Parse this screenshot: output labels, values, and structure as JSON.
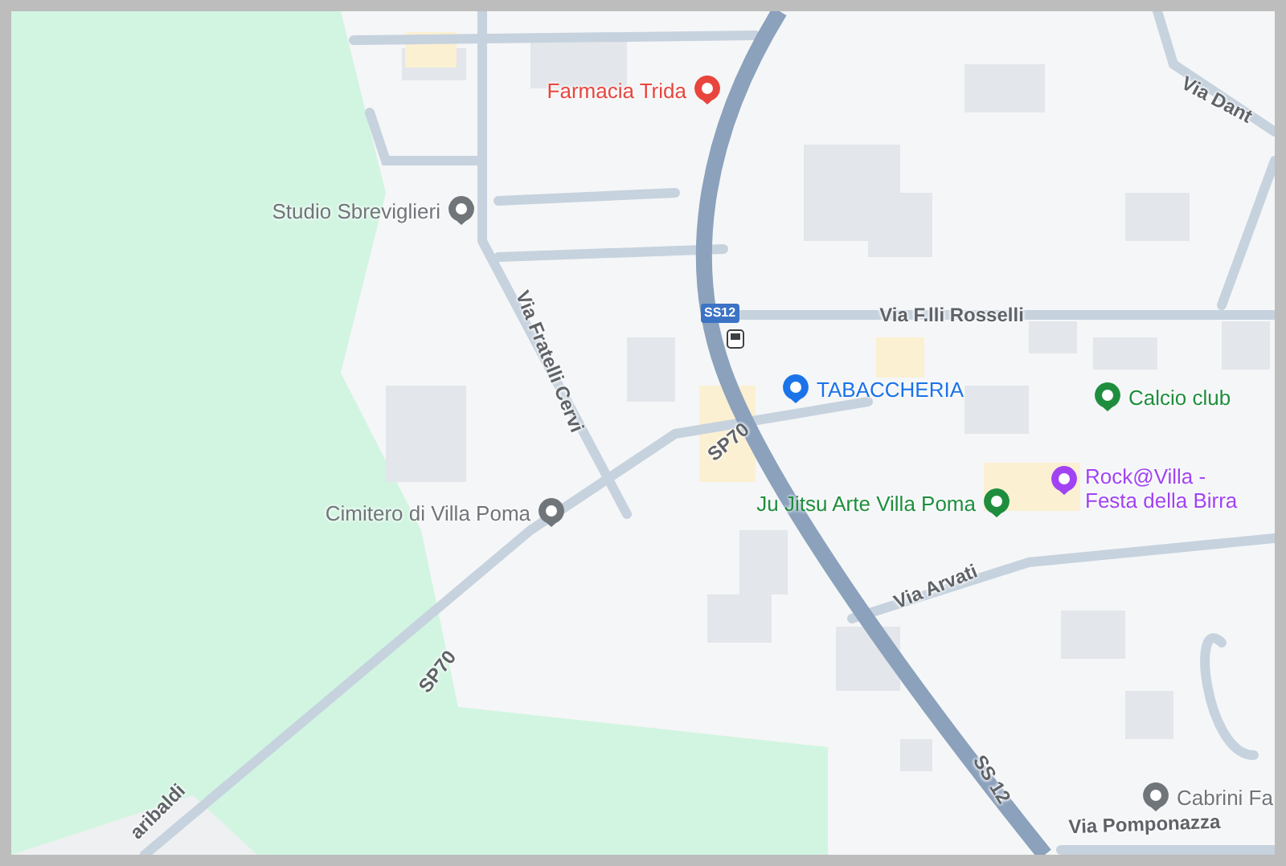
{
  "map": {
    "places": [
      {
        "name": "Farmacia Trida",
        "color": "#e8453c"
      },
      {
        "name": "Studio Sbreviglieri",
        "color": "#70757a"
      },
      {
        "name": "TABACCHERIA",
        "color": "#1a73e8"
      },
      {
        "name": "Calcio club",
        "color": "#1e8e3e"
      },
      {
        "name": "Cimitero di Villa Poma",
        "color": "#70757a"
      },
      {
        "name": "Ju Jitsu Arte Villa Poma",
        "color": "#1e8e3e"
      },
      {
        "name": "Rock@Villa - Festa della Birra",
        "color": "#a142f4"
      },
      {
        "name": "Cabrini Fa",
        "color": "#70757a"
      }
    ],
    "road_labels": [
      "Via Dant",
      "Via F.lli Rosselli",
      "Via Fratelli Cervi",
      "SP70",
      "SP70",
      "Via Arvati",
      "SS 12",
      "aribaldi",
      "Via Pomponazza"
    ],
    "route_shield": "SS12"
  }
}
